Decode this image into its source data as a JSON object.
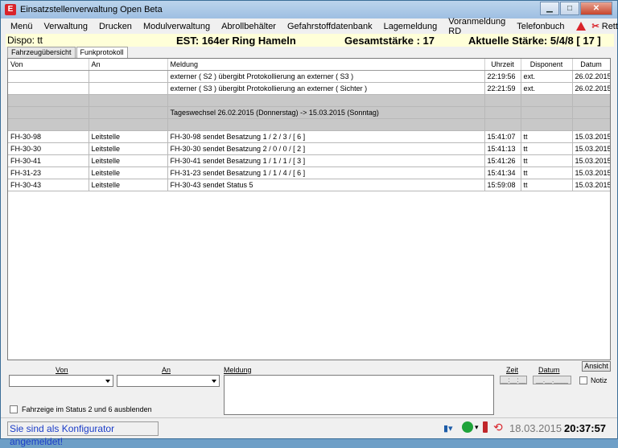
{
  "window": {
    "title": "Einsatzstellenverwaltung Open Beta",
    "icon_letter": "E"
  },
  "menu": [
    "Menü",
    "Verwaltung",
    "Drucken",
    "Modulverwaltung",
    "Abrollbehälter",
    "Gefahrstoffdatenbank",
    "Lagemeldung",
    "Voranmeldung RD",
    "Telefonbuch"
  ],
  "menu_extra": {
    "rettungsk": "Rettungsk."
  },
  "info": {
    "dispo": "Dispo: tt",
    "est": "EST: 164er Ring Hameln",
    "gesamt": "Gesamtstärke :   17",
    "aktuell": "Aktuelle Stärke:  5/4/8 [ 17 ]"
  },
  "tabs": [
    {
      "label": "Fahrzeugübersicht",
      "active": false
    },
    {
      "label": "Funkprotokoll",
      "active": true
    }
  ],
  "table": {
    "headers": {
      "von": "Von",
      "an": "An",
      "meldung": "Meldung",
      "uhrzeit": "Uhrzeit",
      "disponent": "Disponent",
      "datum": "Datum"
    },
    "rows": [
      {
        "von": "",
        "an": "",
        "meldung": "externer ( S2 ) übergibt Protokollierung an externer ( S3 )",
        "uhrzeit": "22:19:56",
        "disponent": "ext.",
        "datum": "26.02.2015",
        "gray": false
      },
      {
        "von": "",
        "an": "",
        "meldung": "externer ( S3 ) übergibt Protokollierung an externer ( Sichter )",
        "uhrzeit": "22:21:59",
        "disponent": "ext.",
        "datum": "26.02.2015",
        "gray": false
      },
      {
        "von": "",
        "an": "",
        "meldung": "",
        "uhrzeit": "",
        "disponent": "",
        "datum": "",
        "gray": true
      },
      {
        "von": "",
        "an": "",
        "meldung": "Tageswechsel 26.02.2015 (Donnerstag) -> 15.03.2015 (Sonntag)",
        "uhrzeit": "",
        "disponent": "",
        "datum": "",
        "gray": true
      },
      {
        "von": "",
        "an": "",
        "meldung": "",
        "uhrzeit": "",
        "disponent": "",
        "datum": "",
        "gray": true
      },
      {
        "von": "FH-30-98",
        "an": "Leitstelle",
        "meldung": "FH-30-98 sendet Besatzung 1 / 2 / 3 / [ 6 ]",
        "uhrzeit": "15:41:07",
        "disponent": "tt",
        "datum": "15.03.2015",
        "gray": false
      },
      {
        "von": "FH-30-30",
        "an": "Leitstelle",
        "meldung": "FH-30-30 sendet Besatzung 2 / 0 / 0 / [ 2 ]",
        "uhrzeit": "15:41:13",
        "disponent": "tt",
        "datum": "15.03.2015",
        "gray": false
      },
      {
        "von": "FH-30-41",
        "an": "Leitstelle",
        "meldung": "FH-30-41 sendet Besatzung 1 / 1 / 1 / [ 3 ]",
        "uhrzeit": "15:41:26",
        "disponent": "tt",
        "datum": "15.03.2015",
        "gray": false
      },
      {
        "von": "FH-31-23",
        "an": "Leitstelle",
        "meldung": "FH-31-23 sendet Besatzung 1 / 1 / 4 / [ 6 ]",
        "uhrzeit": "15:41:34",
        "disponent": "tt",
        "datum": "15.03.2015",
        "gray": false
      },
      {
        "von": "FH-30-43",
        "an": "Leitstelle",
        "meldung": "FH-30-43 sendet Status 5",
        "uhrzeit": "15:59:08",
        "disponent": "tt",
        "datum": "15.03.2015",
        "gray": false
      }
    ]
  },
  "form": {
    "von_label": "Von",
    "an_label": "An",
    "meldung_label": "Meldung",
    "zeit_label": "Zeit",
    "datum_label": "Datum",
    "zeit_value": "__:__:__",
    "datum_value": "__.__.____",
    "ansicht": "Ansicht",
    "notiz": "Notiz",
    "hide_status": "Fahrzeige im Status 2 und 6 ausblenden"
  },
  "status": {
    "message": "Sie sind als Konfigurator angemeldet!",
    "date": "18.03.2015",
    "time": "20:37:57"
  },
  "colors": {
    "info_bar": "#ffffd8",
    "status_text": "#1a3cc8",
    "gray_row": "#c8c8c8",
    "accent_red": "#d9232a"
  }
}
